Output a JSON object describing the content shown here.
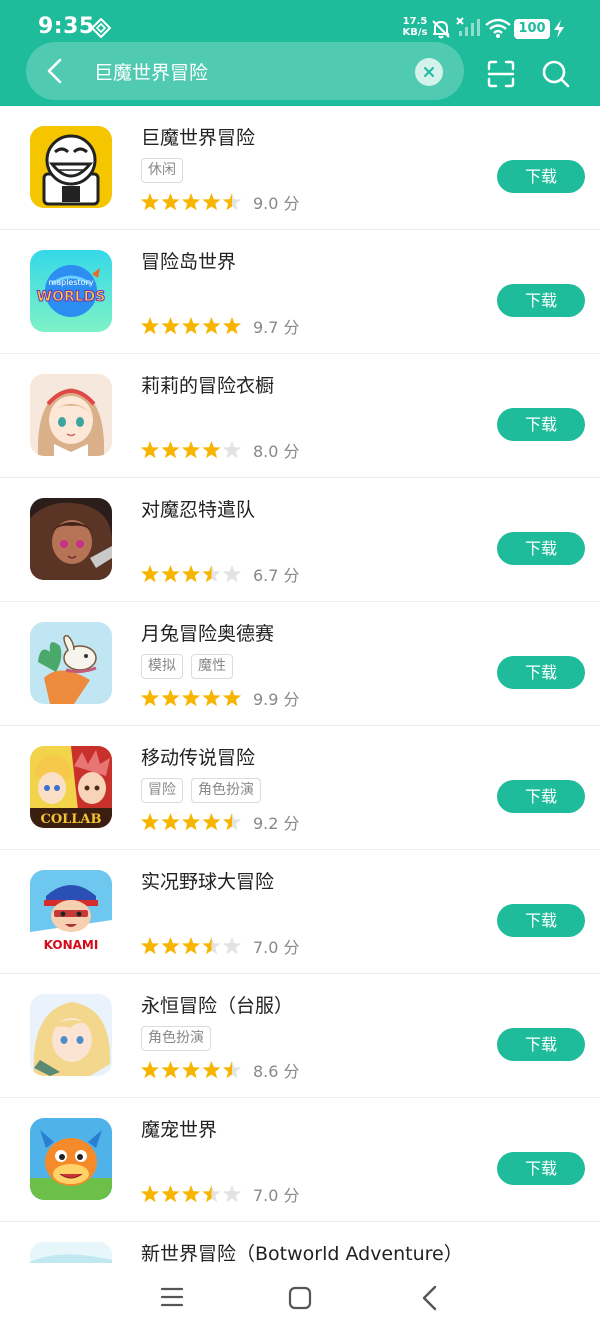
{
  "status_bar": {
    "time": "9:35",
    "net_speed_value": "17.5",
    "net_speed_unit": "KB/s",
    "battery": "100"
  },
  "search": {
    "query": "巨魔世界冒险"
  },
  "download_label": "下载",
  "score_suffix": "分",
  "apps": [
    {
      "title": "巨魔世界冒险",
      "tags": [
        "休闲"
      ],
      "rating": 4.5,
      "score": "9.0 分"
    },
    {
      "title": "冒险岛世界",
      "tags": [],
      "rating": 5,
      "score": "9.7 分"
    },
    {
      "title": "莉莉的冒险衣橱",
      "tags": [],
      "rating": 4,
      "score": "8.0 分"
    },
    {
      "title": "对魔忍特遣队",
      "tags": [],
      "rating": 3.5,
      "score": "6.7 分"
    },
    {
      "title": "月兔冒险奥德赛",
      "tags": [
        "模拟",
        "魔性"
      ],
      "rating": 5,
      "score": "9.9 分"
    },
    {
      "title": "移动传说冒险",
      "tags": [
        "冒险",
        "角色扮演"
      ],
      "rating": 4.5,
      "score": "9.2 分"
    },
    {
      "title": "实况野球大冒险",
      "tags": [],
      "rating": 3.5,
      "score": "7.0 分"
    },
    {
      "title": "永恒冒险（台服）",
      "tags": [
        "角色扮演"
      ],
      "rating": 4.5,
      "score": "8.6 分"
    },
    {
      "title": "魔宠世界",
      "tags": [],
      "rating": 3.5,
      "score": "7.0 分"
    },
    {
      "title": "新世界冒险（Botworld Adventure）",
      "tags": [],
      "rating": null,
      "score": ""
    }
  ],
  "icon_text": {
    "maplestory_small": "maplestory",
    "maplestory_big": "WORLDS",
    "collab": "COLLAB",
    "konami": "KONAMI"
  },
  "colors": {
    "accent": "#1fbc9c",
    "star": "#f7b500",
    "star_empty": "#e3e3e3"
  }
}
